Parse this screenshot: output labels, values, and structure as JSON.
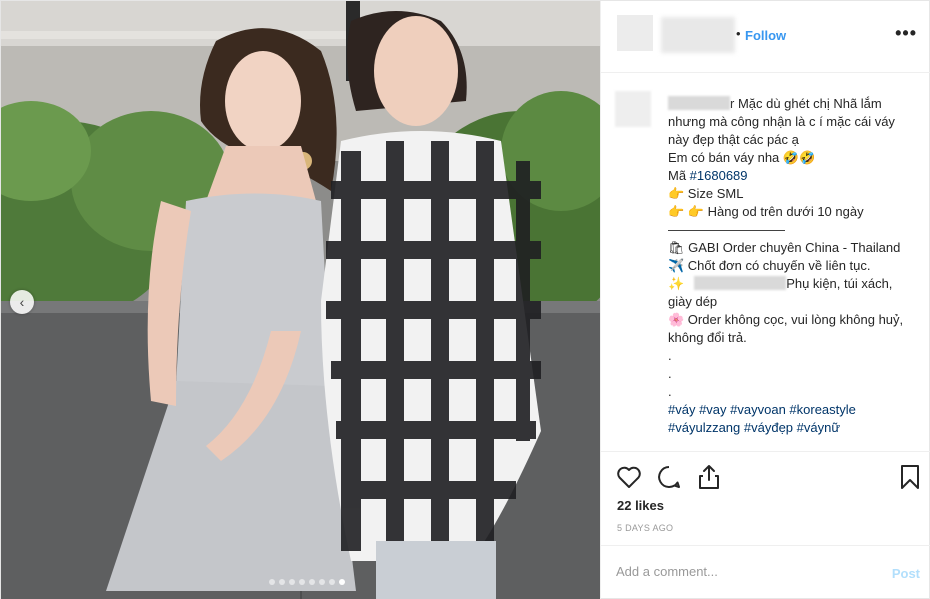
{
  "header": {
    "follow_label": "Follow",
    "separator": "•",
    "more_label": "•••"
  },
  "carousel": {
    "prev_label": "‹",
    "dot_count": 8,
    "active_dot": 7
  },
  "caption": {
    "line1": "r Mặc dù ghét chị Nhã lắm nhưng mà công nhận là c í mặc cái váy này đẹp thật các pác ạ",
    "line2": "Em có bán váy nha 🤣🤣",
    "line3_prefix": "Mã ",
    "line3_tag": "#1680689",
    "line4": "👉 Size SML",
    "line5": "👉 👉 Hàng od trên dưới 10 ngày",
    "line6": "—————————",
    "line7": "🛍 GABI Order chuyên China - Thailand",
    "line8": "✈️ Chốt đơn có chuyến về liên tục.",
    "line9_prefix": "✨",
    "line9_suffix": "Phụ kiện, túi xách, giày dép",
    "line10": "🌸 Order không cọc, vui lòng không huỷ, không đổi trả.",
    "dot1": ".",
    "dot2": ".",
    "dot3": ".",
    "hashtags": "#váy #vay #vayvoan #koreastyle",
    "hashtags2": "#váyulzzang #váyđẹp #váynữ"
  },
  "actions": {
    "likes": "22 likes",
    "time": "5 DAYS AGO"
  },
  "comment": {
    "placeholder": "Add a comment...",
    "post_label": "Post"
  },
  "colors": {
    "link": "#3897f0",
    "hashtag": "#003569",
    "post_disabled": "#b2dffc"
  }
}
